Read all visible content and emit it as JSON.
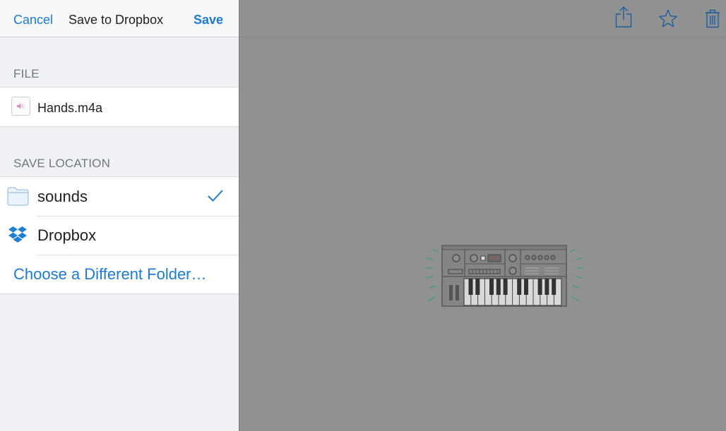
{
  "nav": {
    "cancel_label": "Cancel",
    "title": "Save to Dropbox",
    "save_label": "Save"
  },
  "file_section": {
    "header": "FILE",
    "file_name": "Hands.m4a",
    "file_icon": "audio-file-icon"
  },
  "location_section": {
    "header": "SAVE LOCATION",
    "items": [
      {
        "label": "sounds",
        "icon": "folder-icon",
        "selected": true
      },
      {
        "label": "Dropbox",
        "icon": "dropbox-icon",
        "selected": false
      }
    ],
    "choose_label": "Choose a Different Folder…"
  },
  "toolbar": {
    "icons": [
      "share-icon",
      "star-icon",
      "trash-icon"
    ]
  },
  "preview": {
    "illustration": "synthesizer-illustration"
  },
  "colors": {
    "accent": "#1f7ad1",
    "sheet_bg": "#eff1f4",
    "dimmed_bg": "#919191",
    "sound_wave_green": "#3aa36b"
  }
}
